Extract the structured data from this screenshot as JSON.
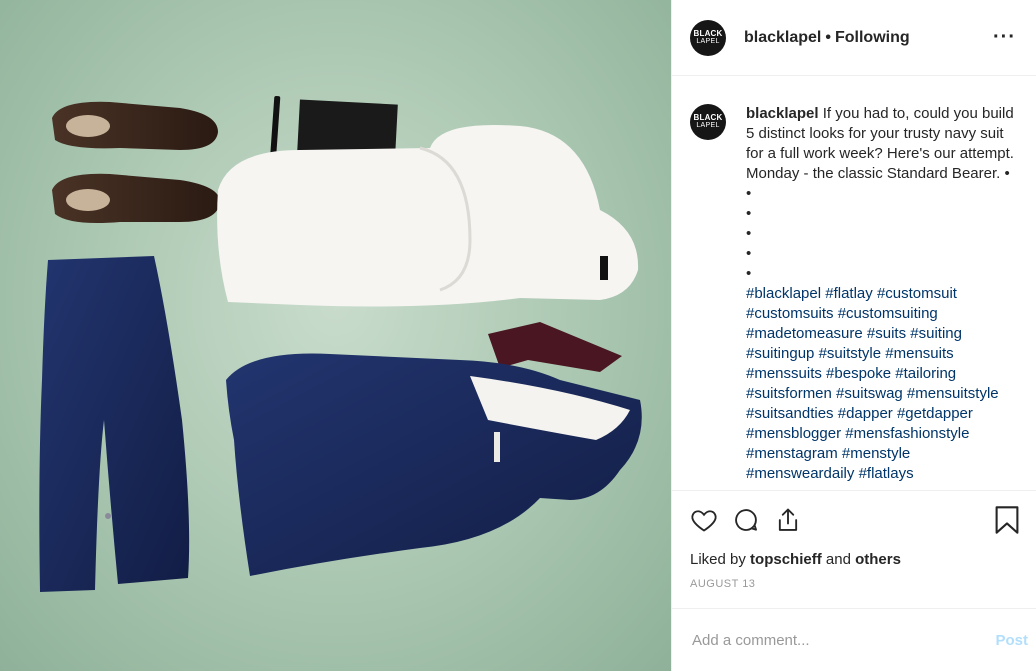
{
  "post": {
    "username": "blacklapel",
    "follow_status": "Following",
    "separator": "•",
    "avatar": {
      "line1": "BLACK",
      "line2": "LAPEL"
    },
    "caption": {
      "username": "blacklapel",
      "text": "If you had to, could you build 5 distinct looks for your trusty navy suit for a full work week? Here's our attempt. Monday - the classic Standard Bearer. •",
      "bullets": [
        "•",
        "•",
        "•",
        "•",
        "•"
      ],
      "hashtags": [
        "#blacklapel",
        "#flatlay",
        "#customsuit",
        "#customsuits",
        "#customsuiting",
        "#madetomeasure",
        "#suits",
        "#suiting",
        "#suitingup",
        "#suitstyle",
        "#mensuits",
        "#menssuits",
        "#bespoke",
        "#tailoring",
        "#suitsformen",
        "#suitswag",
        "#mensuitstyle",
        "#suitsandties",
        "#dapper",
        "#getdapper",
        "#mensblogger",
        "#mensfashionstyle",
        "#menstagram",
        "#menstyle",
        "#mensweardaily",
        "#flatlays"
      ]
    },
    "likes": {
      "prefix": "Liked by",
      "user": "topschieff",
      "conj": "and",
      "others": "others"
    },
    "date": "AUGUST 13",
    "comment": {
      "placeholder": "Add a comment...",
      "post_label": "Post"
    },
    "icons": {
      "more": "more-options-icon",
      "like": "heart-icon",
      "comment": "comment-bubble-icon",
      "share": "share-icon",
      "save": "bookmark-icon"
    },
    "colors": {
      "hashtag": "#003569",
      "post_button": "#b2dffc",
      "background": "#8fb199"
    }
  }
}
